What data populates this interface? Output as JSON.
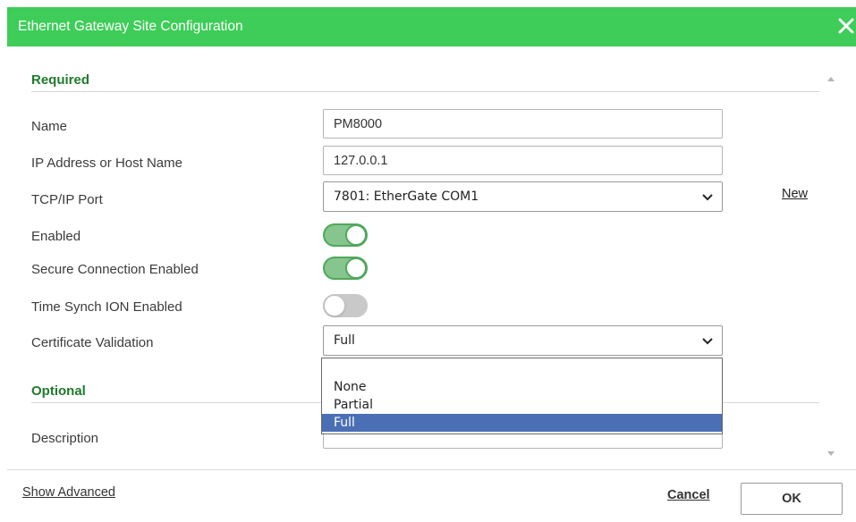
{
  "dialog": {
    "title": "Ethernet Gateway Site Configuration",
    "accent_color": "#3dcd58",
    "close_icon": "close-icon"
  },
  "required": {
    "heading": "Required",
    "fields": {
      "name": {
        "label": "Name",
        "value": "PM8000"
      },
      "ip": {
        "label": "IP Address or Host Name",
        "value": "127.0.0.1"
      },
      "port": {
        "label": "TCP/IP Port",
        "value": "7801: EtherGate COM1",
        "new_link": "New"
      },
      "enabled": {
        "label": "Enabled",
        "on": true
      },
      "secure": {
        "label": "Secure Connection Enabled",
        "on": true
      },
      "time_synch": {
        "label": "Time Synch ION Enabled",
        "on": false
      },
      "cert": {
        "label": "Certificate Validation",
        "value": "Full",
        "options": [
          "None",
          "Partial",
          "Full"
        ],
        "selected_option": "Full"
      }
    }
  },
  "optional": {
    "heading": "Optional",
    "fields": {
      "description": {
        "label": "Description",
        "value": ""
      }
    }
  },
  "footer": {
    "show_advanced": "Show Advanced",
    "cancel": "Cancel",
    "ok": "OK"
  }
}
